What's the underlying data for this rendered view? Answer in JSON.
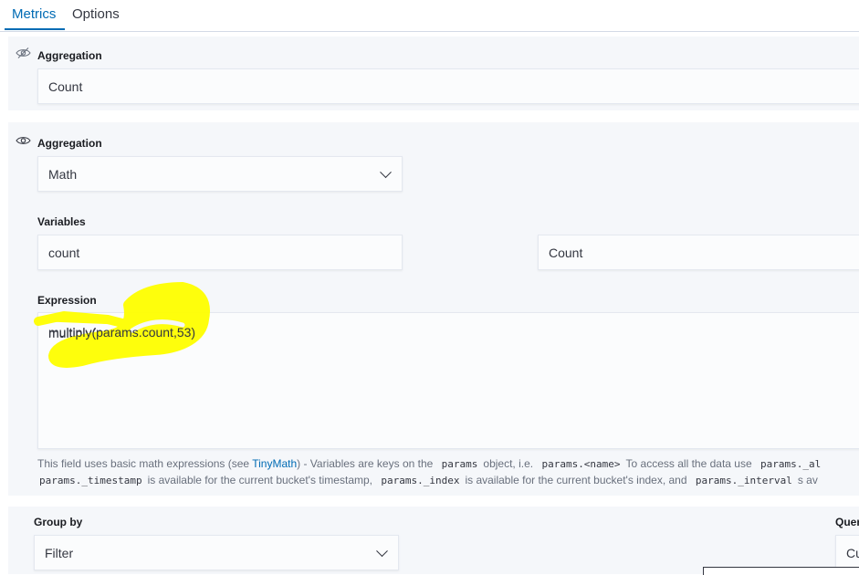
{
  "tabs": [
    {
      "label": "Metrics",
      "active": true
    },
    {
      "label": "Options",
      "active": false
    }
  ],
  "metric1": {
    "aggregation_label": "Aggregation",
    "aggregation_value": "Count",
    "visibility_icon": "eye-closed-icon"
  },
  "metric2": {
    "aggregation_label": "Aggregation",
    "aggregation_value": "Math",
    "visibility_icon": "eye-icon",
    "variables_label": "Variables",
    "variable_name": "count",
    "variable_metric": "Count",
    "expression_label": "Expression",
    "expression_value": "multiply(params.count,53)",
    "help": {
      "t1": "This field uses basic math expressions (see ",
      "link": "TinyMath",
      "t2": ") - Variables are keys on the",
      "code1": "params",
      "t3": "object, i.e.",
      "code2": "params.<name>",
      "t4": "To access all the data use",
      "code3": "params._al",
      "code4": "params._timestamp",
      "t5": "is available for the current bucket's timestamp,",
      "code5": "params._index",
      "t6": "is available for the current bucket's index, and",
      "code6": "params._interval",
      "t7": "s av"
    }
  },
  "group": {
    "label": "Group by",
    "value": "Filter",
    "query_label": "Quer",
    "query_value": "Cu"
  },
  "colors": {
    "accent": "#006bb4",
    "panel": "#f5f7fa",
    "highlight": "#ffff00"
  }
}
